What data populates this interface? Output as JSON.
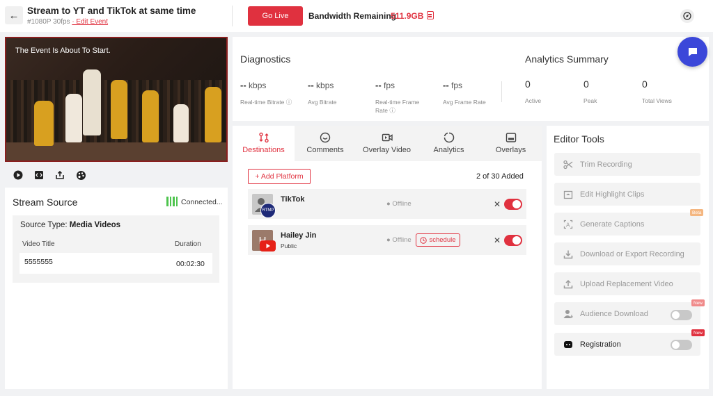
{
  "header": {
    "back_icon": "arrow-left-icon",
    "title": "Stream to YT and TikTok at same time",
    "meta": "#1080P 30fps",
    "edit_event": "· Edit Event",
    "go_live": "Go Live",
    "bandwidth_label": "Bandwidth Remaining",
    "bandwidth_value": "511.9GB"
  },
  "video": {
    "overlay_text": "The Event Is About To Start."
  },
  "stream_source": {
    "title": "Stream Source",
    "status": "Connected...",
    "source_type_label": "Source Type:",
    "source_type_value": "Media Videos",
    "columns": [
      "Video Title",
      "Duration"
    ],
    "rows": [
      {
        "title": "5555555",
        "duration": "00:02:30"
      }
    ]
  },
  "diagnostics": {
    "title": "Diagnostics",
    "metrics": [
      {
        "value": "--",
        "unit": "kbps",
        "label": "Real-time Bitrate",
        "info": true
      },
      {
        "value": "--",
        "unit": "kbps",
        "label": "Avg Bitrate"
      },
      {
        "value": "--",
        "unit": "fps",
        "label": "Real-time Frame",
        "label2": "Rate",
        "info": true
      },
      {
        "value": "--",
        "unit": "fps",
        "label": "Avg Frame Rate"
      }
    ]
  },
  "analytics": {
    "title": "Analytics Summary",
    "items": [
      {
        "value": "0",
        "label": "Active"
      },
      {
        "value": "0",
        "label": "Peak"
      },
      {
        "value": "0",
        "label": "Total Views"
      }
    ]
  },
  "tabs": [
    {
      "label": "Destinations",
      "icon": "destinations-icon",
      "active": true
    },
    {
      "label": "Comments",
      "icon": "comments-icon"
    },
    {
      "label": "Overlay Video",
      "icon": "overlay-video-icon"
    },
    {
      "label": "Analytics",
      "icon": "analytics-icon"
    },
    {
      "label": "Overlays",
      "icon": "overlays-icon"
    }
  ],
  "destinations": {
    "add_platform": "+ Add Platform",
    "count": "2 of 30 Added",
    "items": [
      {
        "name": "TikTok",
        "badge": "RTMP",
        "status": "Offline"
      },
      {
        "name": "Hailey Jin",
        "avatar_letter": "H",
        "sub": "Public",
        "status": "Offline",
        "schedule": "schedule"
      }
    ]
  },
  "editor_tools": {
    "title": "Editor Tools",
    "items": [
      {
        "label": "Trim Recording",
        "icon": "scissors-icon"
      },
      {
        "label": "Edit Highlight Clips",
        "icon": "highlight-clips-icon"
      },
      {
        "label": "Generate Captions",
        "icon": "captions-icon",
        "badge": "Beta"
      },
      {
        "label": "Download or Export Recording",
        "icon": "download-icon"
      },
      {
        "label": "Upload Replacement Video",
        "icon": "upload-icon"
      },
      {
        "label": "Audience Download",
        "icon": "audience-download-icon",
        "badge": "New"
      },
      {
        "label": "Registration",
        "icon": "registration-icon",
        "badge": "New"
      }
    ]
  },
  "colors": {
    "accent": "#e0313f",
    "chat": "#3b47d9",
    "connected": "#4ec44e"
  }
}
